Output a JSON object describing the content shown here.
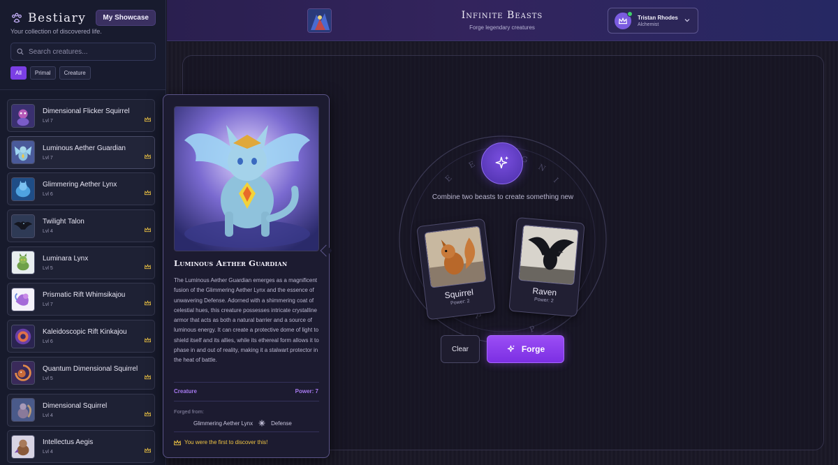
{
  "sidebar": {
    "brand_title": "Bestiary",
    "brand_subtitle": "Your collection of discovered life.",
    "showcase_label": "My Showcase",
    "search_placeholder": "Search creatures...",
    "filters": [
      "All",
      "Primal",
      "Creature"
    ],
    "active_filter": "All",
    "items": [
      {
        "name": "Dimensional Flicker Squirrel",
        "level": "Lvl 7",
        "crown": true
      },
      {
        "name": "Luminous Aether Guardian",
        "level": "Lvl 7",
        "crown": true
      },
      {
        "name": "Glimmering Aether Lynx",
        "level": "Lvl 6",
        "crown": true
      },
      {
        "name": "Twilight Talon",
        "level": "Lvl 4",
        "crown": true
      },
      {
        "name": "Luminara Lynx",
        "level": "Lvl 5",
        "crown": true
      },
      {
        "name": "Prismatic Rift Whimsikajou",
        "level": "Lvl 7",
        "crown": true
      },
      {
        "name": "Kaleidoscopic Rift Kinkajou",
        "level": "Lvl 6",
        "crown": true
      },
      {
        "name": "Quantum Dimensional Squirrel",
        "level": "Lvl 5",
        "crown": true
      },
      {
        "name": "Dimensional Squirrel",
        "level": "Lvl 4",
        "crown": true
      },
      {
        "name": "Intellectus Aegis",
        "level": "Lvl 4",
        "crown": true
      }
    ]
  },
  "header": {
    "title": "Infinite Beasts",
    "subtitle": "Forge legendary creatures",
    "user_name": "Tristan Rhodes",
    "user_role": "Alchemist"
  },
  "detail": {
    "title": "Luminous Aether Guardian",
    "description": "The Luminous Aether Guardian emerges as a magnificent fusion of the Glimmering Aether Lynx and the essence of unwavering Defense. Adorned with a shimmering coat of celestial hues, this creature possesses intricate crystalline armor that acts as both a natural barrier and a source of luminous energy. It can create a protective dome of light to shield itself and its allies, while its ethereal form allows it to phase in and out of reality, making it a stalwart protector in the heat of battle.",
    "type": "Creature",
    "power": "Power: 7",
    "forged_from_label": "Forged from:",
    "forged_from_beast": "Glimmering Aether Lynx",
    "forged_from_essence": "Defense",
    "first_discovery": "You were the first to discover this!"
  },
  "forge": {
    "instruction": "Combine two beasts to create something new",
    "slot_left": {
      "name": "Squirrel",
      "power": "Power: 2"
    },
    "slot_right": {
      "name": "Raven",
      "power": "Power: 2"
    },
    "clear_label": "Clear",
    "forge_label": "Forge"
  },
  "colors": {
    "accent": "#7b3fe4",
    "accent_text": "#a77af0",
    "gold": "#f2c744",
    "online": "#3fd06a"
  },
  "icons": {
    "brand": "paw-icon",
    "search": "search-icon",
    "crown": "crown-icon",
    "chevron": "chevron-down-icon",
    "orb": "sparkles-icon",
    "forge": "sparkles-icon"
  }
}
